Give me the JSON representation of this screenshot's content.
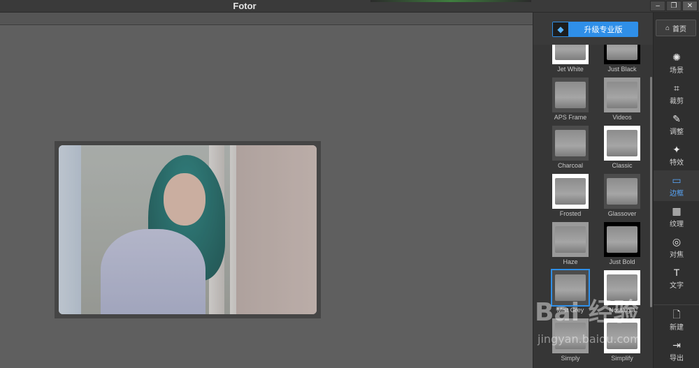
{
  "window": {
    "title": "Fotor",
    "buttons": {
      "minimize": "–",
      "restore": "❐",
      "close": "✕"
    }
  },
  "panel": {
    "upgrade_label": "升级专业版",
    "upgrade_icon": "diamond-icon",
    "frames": [
      {
        "name": "Jet White",
        "style": "white"
      },
      {
        "name": "Just Black",
        "style": "black"
      },
      {
        "name": "APS Frame",
        "style": "dark"
      },
      {
        "name": "Videos",
        "style": "light"
      },
      {
        "name": "Charcoal",
        "style": "dark"
      },
      {
        "name": "Classic",
        "style": "white"
      },
      {
        "name": "Frosted",
        "style": "white"
      },
      {
        "name": "Glassover",
        "style": "dark"
      },
      {
        "name": "Haze",
        "style": "light"
      },
      {
        "name": "Just Bold",
        "style": "black"
      },
      {
        "name": "Mist Grey",
        "style": "dark",
        "selected": true
      },
      {
        "name": "Nostalgia",
        "style": "white"
      },
      {
        "name": "Simply",
        "style": "light"
      },
      {
        "name": "Simplify",
        "style": "white"
      }
    ]
  },
  "toolbar": {
    "home_label": "首页",
    "tools": [
      {
        "label": "场景",
        "icon": "sun-icon",
        "glyph": "✺"
      },
      {
        "label": "裁剪",
        "icon": "crop-icon",
        "glyph": "⌗"
      },
      {
        "label": "调整",
        "icon": "pencil-icon",
        "glyph": "✎"
      },
      {
        "label": "特效",
        "icon": "sparkle-icon",
        "glyph": "✦"
      },
      {
        "label": "边框",
        "icon": "frame-icon",
        "glyph": "▭",
        "active": true
      },
      {
        "label": "纹理",
        "icon": "checker-icon",
        "glyph": "▦"
      },
      {
        "label": "对焦",
        "icon": "focus-icon",
        "glyph": "◎"
      },
      {
        "label": "文字",
        "icon": "text-icon",
        "glyph": "T"
      },
      {
        "label": "新建",
        "icon": "new-file-icon",
        "glyph": "🗋"
      },
      {
        "label": "导出",
        "icon": "export-icon",
        "glyph": "⇥"
      }
    ]
  },
  "watermark": {
    "main": "Bai 经验",
    "sub": "jingyan.baidu.com"
  },
  "colors": {
    "accent": "#2f8fe8",
    "active_tool": "#59a9ff"
  }
}
